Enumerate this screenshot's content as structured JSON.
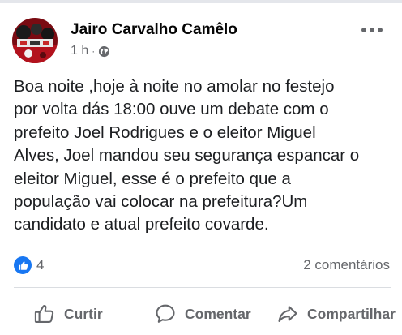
{
  "post": {
    "author": "Jairo Carvalho Camêlo",
    "time": "1 h",
    "separator": "·",
    "privacy_icon": "globe-icon",
    "more_icon": "more-options-icon",
    "text_lines": [
      "Boa noite ,hoje à noite  no amolar no festejo",
      "por volta dás 18:00 ouve um debate com o",
      "prefeito Joel Rodrigues e o eleitor Miguel",
      "Alves, Joel mandou seu segurança espancar o",
      "eleitor Miguel, esse é o prefeito que a",
      "população vai colocar na prefeitura?Um",
      "candidato e atual prefeito covarde."
    ]
  },
  "stats": {
    "reaction_icon": "like-reaction-icon",
    "reactions_count": "4",
    "comments": "2 comentários"
  },
  "actions": {
    "like_label": "Curtir",
    "comment_label": "Comentar",
    "share_label": "Compartilhar"
  },
  "colors": {
    "accent": "#1877f2",
    "secondary_text": "#65676b",
    "divider": "#dadde1"
  }
}
